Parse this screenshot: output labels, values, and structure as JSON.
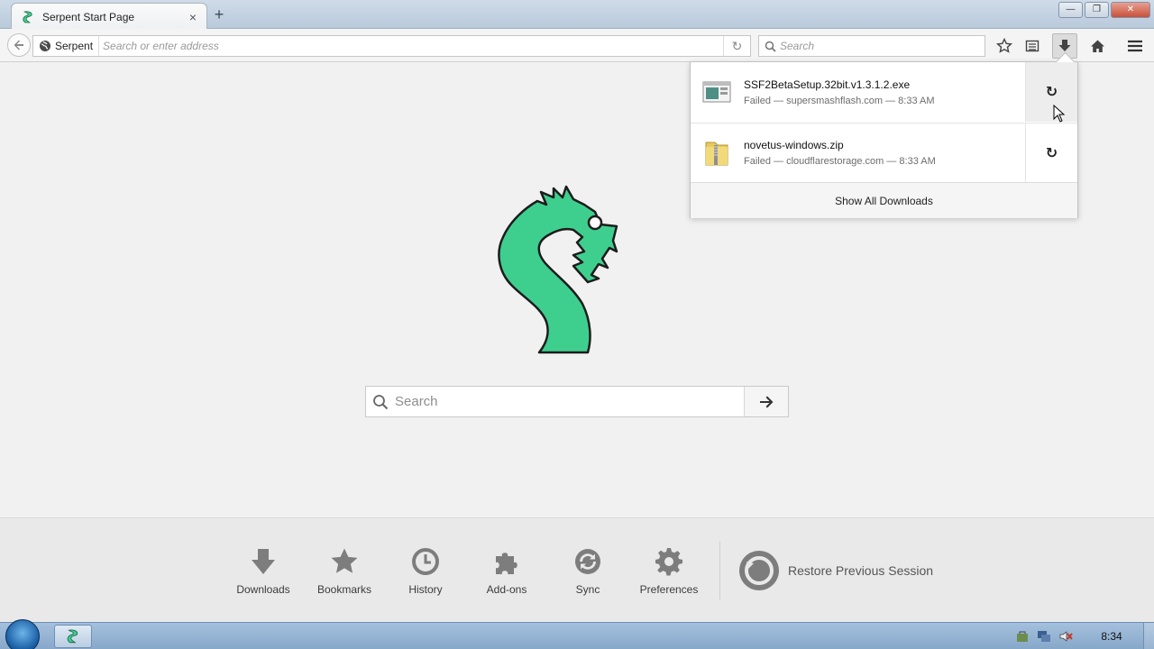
{
  "browser": {
    "tab": {
      "title": "Serpent Start Page",
      "close": "×"
    },
    "new_tab": "+",
    "window_buttons": {
      "minimize": "—",
      "restore": "❐",
      "close": "✕"
    }
  },
  "navbar": {
    "identity_label": "Serpent",
    "url_placeholder": "Search or enter address",
    "search_placeholder": "Search",
    "reload": "↻"
  },
  "downloads_panel": {
    "items": [
      {
        "name": "SSF2BetaSetup.32bit.v1.3.1.2.exe",
        "status": "Failed — supersmashflash.com — 8:33 AM",
        "icon": "exe-file-icon",
        "retry": "↻"
      },
      {
        "name": "novetus-windows.zip",
        "status": "Failed — cloudflarestorage.com — 8:33 AM",
        "icon": "zip-folder-icon",
        "retry": "↻"
      }
    ],
    "footer": "Show All Downloads"
  },
  "main": {
    "search_placeholder": "Search",
    "brand_color": "#3ecf8e"
  },
  "launcher": {
    "items": [
      {
        "label": "Downloads",
        "icon": "download-arrow-icon"
      },
      {
        "label": "Bookmarks",
        "icon": "star-icon"
      },
      {
        "label": "History",
        "icon": "clock-icon"
      },
      {
        "label": "Add-ons",
        "icon": "puzzle-icon"
      },
      {
        "label": "Sync",
        "icon": "sync-icon"
      },
      {
        "label": "Preferences",
        "icon": "gear-icon"
      }
    ],
    "restore_label": "Restore Previous Session"
  },
  "taskbar": {
    "clock": "8:34"
  }
}
